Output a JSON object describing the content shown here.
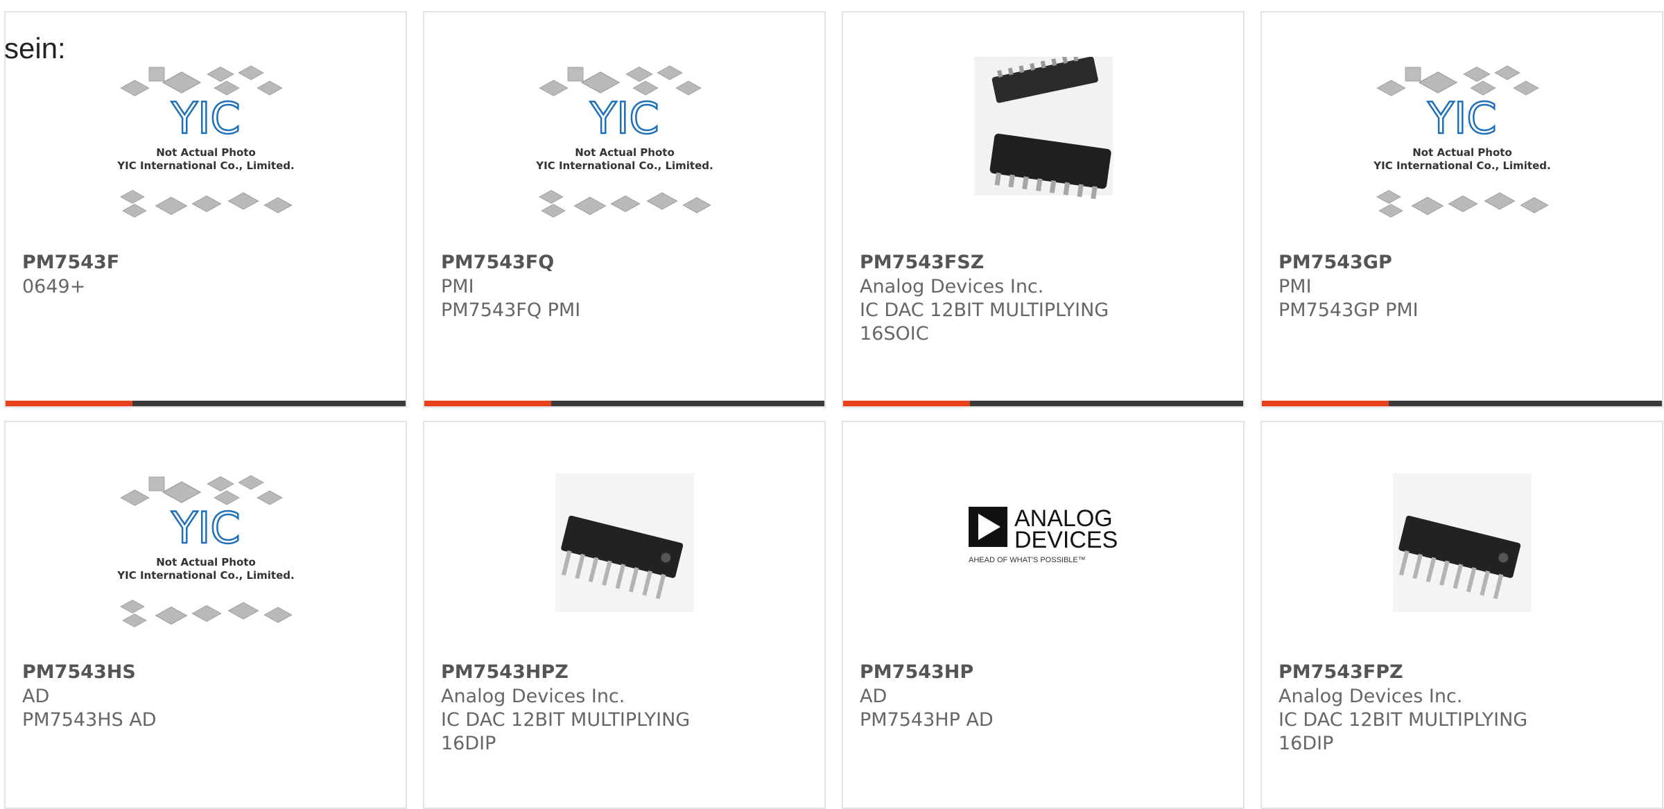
{
  "intro_text": "sein:",
  "colors": {
    "accent": "#e8411b",
    "bar_dark": "#3a3a3a",
    "yic_blue": "#1d6fb8"
  },
  "placeholder": {
    "line1": "Not Actual Photo",
    "line2": "YIC International Co., Limited.",
    "logo": "YIC"
  },
  "adi_logo": {
    "line1": "ANALOG",
    "line2": "DEVICES",
    "tagline": "AHEAD OF WHAT'S POSSIBLE™"
  },
  "cards": [
    {
      "name": "PM7543F",
      "image": "yic-placeholder",
      "lines": [
        "0649+",
        "",
        ""
      ]
    },
    {
      "name": "PM7543FQ",
      "image": "yic-placeholder",
      "lines": [
        "PMI",
        "PM7543FQ PMI",
        ""
      ]
    },
    {
      "name": "PM7543FSZ",
      "image": "soic-chip-photo",
      "lines": [
        "Analog Devices Inc.",
        "IC DAC 12BIT MULTIPLYING",
        "16SOIC"
      ]
    },
    {
      "name": "PM7543GP",
      "image": "yic-placeholder",
      "lines": [
        "PMI",
        "PM7543GP PMI",
        ""
      ]
    },
    {
      "name": "PM7543HS",
      "image": "yic-placeholder",
      "lines": [
        "AD",
        "PM7543HS AD",
        ""
      ]
    },
    {
      "name": "PM7543HPZ",
      "image": "dip-chip-photo",
      "lines": [
        "Analog Devices Inc.",
        "IC DAC 12BIT MULTIPLYING",
        "16DIP"
      ]
    },
    {
      "name": "PM7543HP",
      "image": "analog-devices-logo",
      "lines": [
        "AD",
        "PM7543HP AD",
        ""
      ]
    },
    {
      "name": "PM7543FPZ",
      "image": "dip-chip-photo",
      "lines": [
        "Analog Devices Inc.",
        "IC DAC 12BIT MULTIPLYING",
        "16DIP"
      ]
    }
  ]
}
